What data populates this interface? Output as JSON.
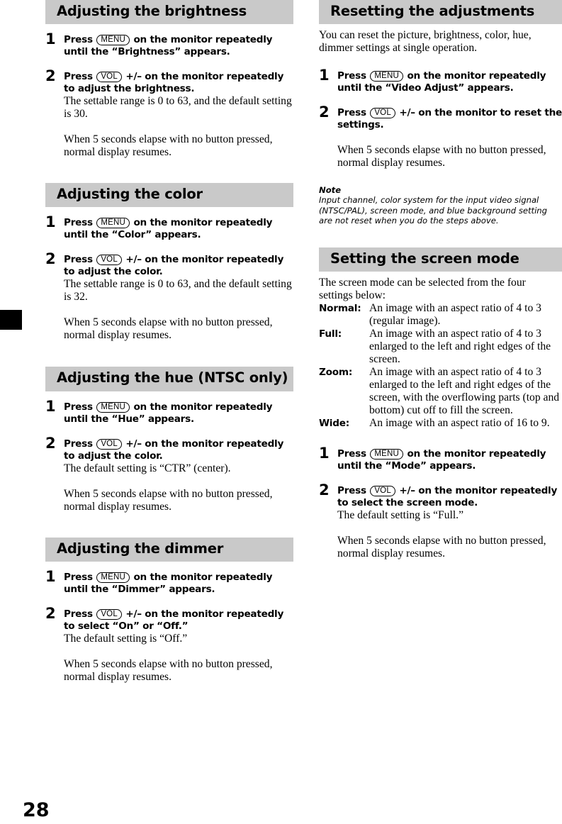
{
  "page": {
    "number": "28",
    "edge_tab": "black-chapter-tab"
  },
  "keys": {
    "menu": "MENU",
    "vol": "VOL"
  },
  "left_column": {
    "sections": [
      {
        "heading": "Adjusting the brightness",
        "steps": [
          {
            "number": "1",
            "lead_pre": "Press",
            "key": "MENU",
            "lead_post": "on the monitor repeatedly until the “Brightness” appears.",
            "body": "",
            "note": ""
          },
          {
            "number": "2",
            "lead_pre": "Press",
            "key": "VOL",
            "lead_post": "+/– on the monitor repeatedly to adjust the brightness.",
            "body": "The settable range is 0 to 63, and the default setting is 30.",
            "note": "When 5 seconds elapse with no button pressed, normal display resumes."
          }
        ]
      },
      {
        "heading": "Adjusting the color",
        "steps": [
          {
            "number": "1",
            "lead_pre": "Press",
            "key": "MENU",
            "lead_post": "on the monitor repeatedly until the “Color” appears.",
            "body": "",
            "note": ""
          },
          {
            "number": "2",
            "lead_pre": "Press",
            "key": "VOL",
            "lead_post": "+/– on the monitor repeatedly to adjust the color.",
            "body": "The settable range is 0 to 63, and the default setting is 32.",
            "note": "When 5 seconds elapse with no button pressed, normal display resumes."
          }
        ]
      },
      {
        "heading": "Adjusting the hue (NTSC only)",
        "steps": [
          {
            "number": "1",
            "lead_pre": "Press",
            "key": "MENU",
            "lead_post": "on the monitor repeatedly until the “Hue” appears.",
            "body": "",
            "note": ""
          },
          {
            "number": "2",
            "lead_pre": "Press",
            "key": "VOL",
            "lead_post": "+/– on the monitor repeatedly to adjust the color.",
            "body": "The default setting is “CTR” (center).",
            "note": "When 5 seconds elapse with no button pressed, normal display resumes."
          }
        ]
      },
      {
        "heading": "Adjusting the dimmer",
        "steps": [
          {
            "number": "1",
            "lead_pre": "Press",
            "key": "MENU",
            "lead_post": "on the monitor repeatedly until the “Dimmer” appears.",
            "body": "",
            "note": ""
          },
          {
            "number": "2",
            "lead_pre": "Press",
            "key": "VOL",
            "lead_post": "+/– on the monitor repeatedly to select “On” or “Off.”",
            "body": "The default setting is “Off.”",
            "note": "When 5 seconds elapse with no button pressed, normal display resumes."
          }
        ]
      }
    ]
  },
  "right_column": {
    "reset_section": {
      "heading": "Resetting the adjustments",
      "intro": "You can reset the picture, brightness, color, hue, dimmer settings at single operation.",
      "steps": [
        {
          "number": "1",
          "lead_pre": "Press",
          "key": "MENU",
          "lead_post": "on the monitor repeatedly until the “Video Adjust” appears.",
          "body": "",
          "note": ""
        },
        {
          "number": "2",
          "lead_pre": "Press",
          "key": "VOL",
          "lead_post": "+/– on the monitor to reset the settings.",
          "body": "",
          "note": "When 5 seconds elapse with no button pressed, normal display resumes."
        }
      ],
      "note_title": "Note",
      "note_body": "Input channel, color system for the input video signal (NTSC/PAL), screen mode, and blue background setting are not reset when you do the steps above."
    },
    "screen_mode_section": {
      "heading": "Setting the screen mode",
      "intro": "The screen mode can be selected from the four settings below:",
      "modes": [
        {
          "term": "Normal:",
          "desc": "An image with an aspect ratio of 4 to 3 (regular image)."
        },
        {
          "term": "Full:",
          "desc": "An image with an aspect ratio of 4 to 3 enlarged to the left and right edges of the screen."
        },
        {
          "term": "Zoom:",
          "desc": "An image with an aspect ratio of 4 to 3 enlarged to the left and right edges of the screen, with the overflowing parts (top and bottom) cut off to fill the screen."
        },
        {
          "term": "Wide:",
          "desc": "An image with an aspect ratio of 16 to 9."
        }
      ],
      "steps": [
        {
          "number": "1",
          "lead_pre": "Press",
          "key": "MENU",
          "lead_post": "on the monitor repeatedly until the “Mode” appears.",
          "body": "",
          "note": ""
        },
        {
          "number": "2",
          "lead_pre": "Press",
          "key": "VOL",
          "lead_post": "+/– on the monitor repeatedly to select the screen mode.",
          "body": "The default setting is “Full.”",
          "note": "When 5 seconds elapse with no button pressed, normal display resumes."
        }
      ]
    }
  },
  "colors": {
    "heading_band": "#c9c9c9",
    "text": "#000000",
    "page_background": "#ffffff"
  }
}
